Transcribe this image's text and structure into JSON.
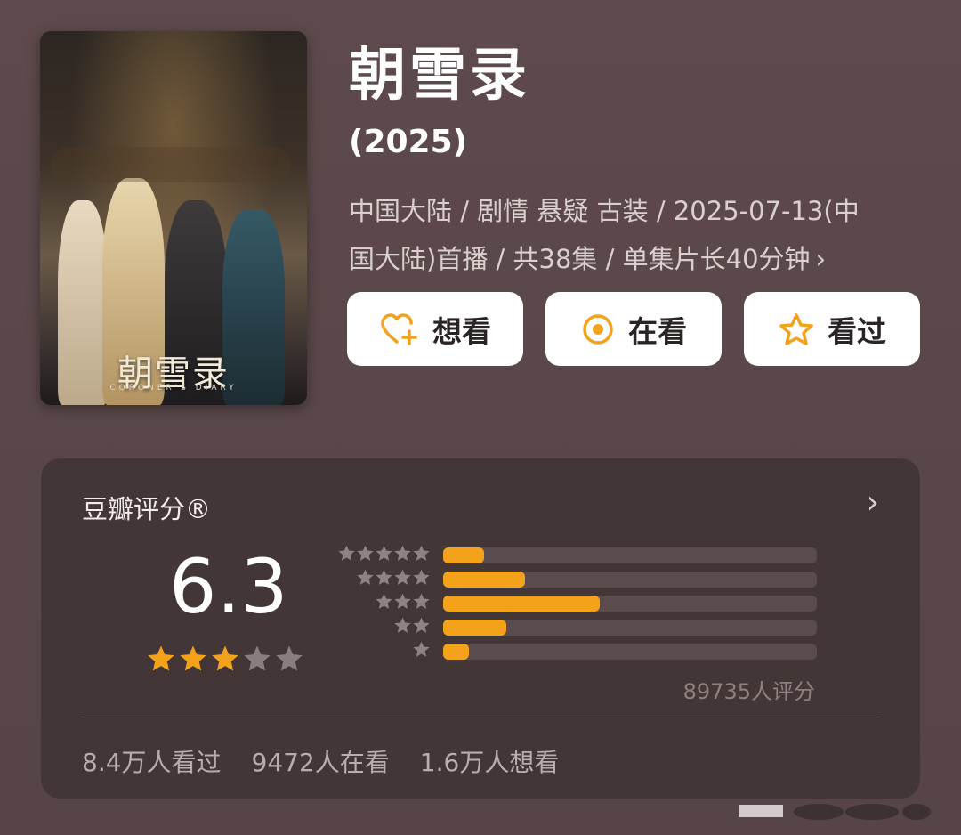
{
  "movie": {
    "title": "朝雪录",
    "year": "(2025)",
    "meta_line1": "中国大陆 / 剧情 悬疑 古装 / 2025-07-13(中",
    "meta_line2": "国大陆)首播 / 共38集 / 单集片长40分钟",
    "meta_chevron": "›",
    "poster_title_cn": "朝雪录",
    "poster_title_en": "CORONER'S DIARY"
  },
  "actions": [
    {
      "label": "想看",
      "icon": "heart-plus-icon"
    },
    {
      "label": "在看",
      "icon": "target-icon"
    },
    {
      "label": "看过",
      "icon": "star-outline-icon"
    }
  ],
  "rating": {
    "card_title": "豆瓣评分®",
    "chevron": "›",
    "score": "6.3",
    "stars_filled": 3,
    "stars_total": 5,
    "distribution": [
      {
        "stars": 5,
        "fraction": 0.11
      },
      {
        "stars": 4,
        "fraction": 0.22
      },
      {
        "stars": 3,
        "fraction": 0.42
      },
      {
        "stars": 2,
        "fraction": 0.17
      },
      {
        "stars": 1,
        "fraction": 0.07
      }
    ],
    "rater_count": "89735人评分",
    "stats": {
      "watched": "8.4万人看过",
      "watching": "9472人在看",
      "want": "1.6万人想看"
    }
  },
  "colors": {
    "accent": "#f5a21b",
    "background": "#5a4749",
    "card": "#433637"
  }
}
